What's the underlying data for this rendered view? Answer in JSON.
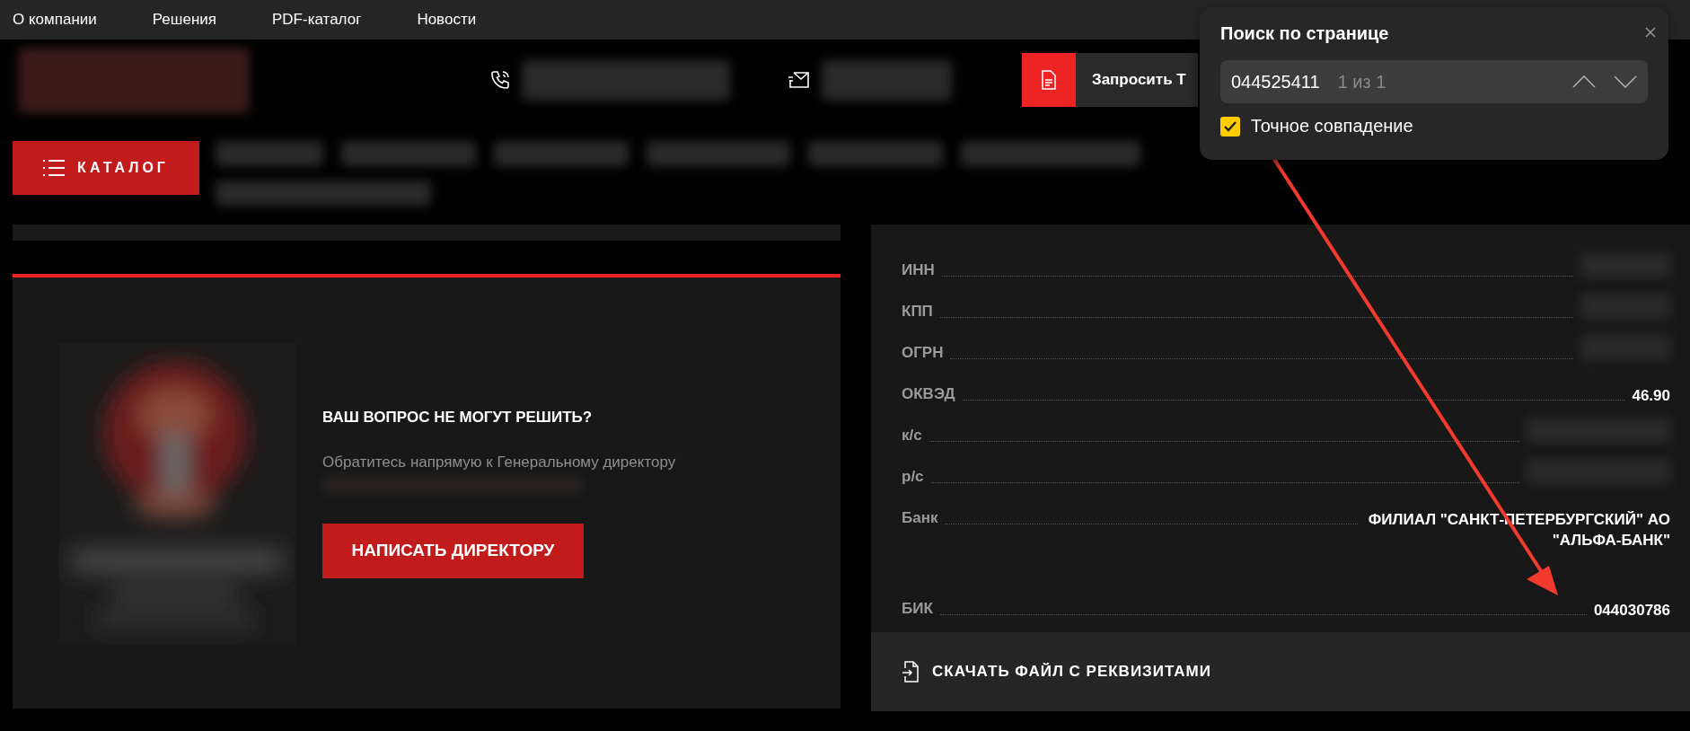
{
  "top_nav": {
    "items": [
      "О компании",
      "Решения",
      "PDF-каталог",
      "Новости"
    ]
  },
  "header": {
    "request_button": "Запросить Т",
    "catalog_button": "КАТАЛОГ"
  },
  "director": {
    "title": "ВАШ ВОПРОС НЕ МОГУТ РЕШИТЬ?",
    "text": "Обратитесь напрямую к Генеральному директору",
    "button": "НАПИСАТЬ ДИРЕКТОРУ"
  },
  "requisites": {
    "rows": [
      {
        "label": "ИНН",
        "kind": "blurred"
      },
      {
        "label": "КПП",
        "kind": "blurred"
      },
      {
        "label": "ОГРН",
        "kind": "blurred"
      },
      {
        "label": "ОКВЭД",
        "kind": "text",
        "value": "46.90"
      },
      {
        "label": "к/с",
        "kind": "blurred"
      },
      {
        "label": "р/с",
        "kind": "blurred"
      },
      {
        "label": "Банк",
        "kind": "text",
        "value": "ФИЛИАЛ \"САНКТ-ПЕТЕРБУРГСКИЙ\" АО \"АЛЬФА-БАНК\""
      },
      {
        "label": "БИК",
        "kind": "text",
        "value": "044030786"
      }
    ],
    "download": "СКАЧАТЬ ФАЙЛ С РЕКВИЗИТАМИ"
  },
  "find_popup": {
    "title": "Поиск по странице",
    "query": "044525411",
    "count": "1 из 1",
    "exact_match": {
      "label": "Точное совпадение",
      "checked": true
    }
  }
}
